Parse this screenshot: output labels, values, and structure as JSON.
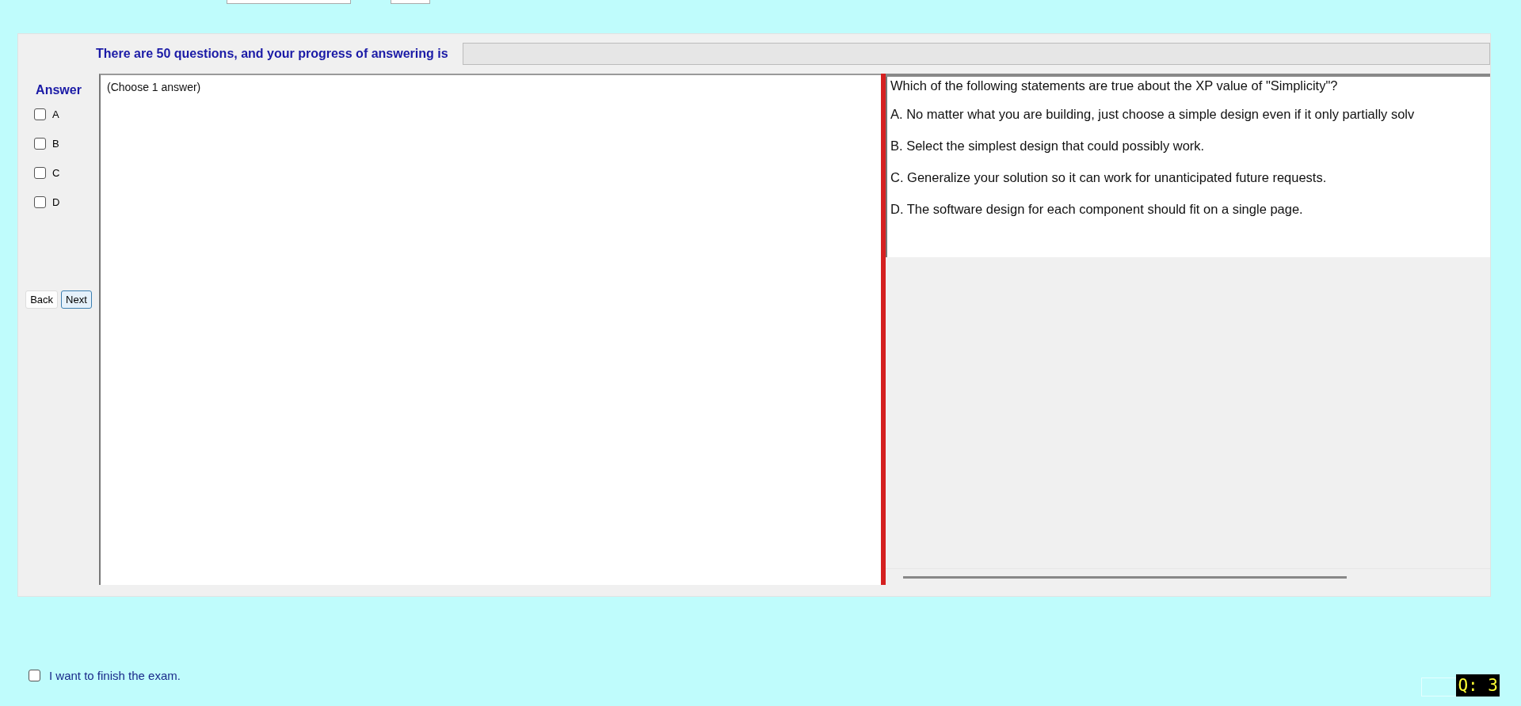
{
  "header": {
    "progress_label": "There are 50 questions, and your progress of answering is",
    "progress": {
      "level": 0
    }
  },
  "answer_panel": {
    "title": "Answer",
    "options": [
      {
        "label": "A",
        "checked": false
      },
      {
        "label": "B",
        "checked": false
      },
      {
        "label": "C",
        "checked": false
      },
      {
        "label": "D",
        "checked": false
      }
    ],
    "buttons": [
      {
        "label": "Back",
        "selected": false
      },
      {
        "label": "Next",
        "selected": true
      }
    ],
    "answer_box_text": "(Choose 1 answer)"
  },
  "question": {
    "text": "Which of the following statements are true about the XP value of \"Simplicity\"?",
    "choices": [
      "A.  No matter what you are building,  just choose a simple design even if it only partially solv",
      "B.  Select the simplest design that could possibly work.",
      "C.  Generalize your solution so it can work for unanticipated future requests.",
      "D.  The software design for each component should fit on a single page."
    ]
  },
  "finish": {
    "label": "I want to finish the exam.",
    "checked": false
  },
  "question_counter": "Q: 3"
}
